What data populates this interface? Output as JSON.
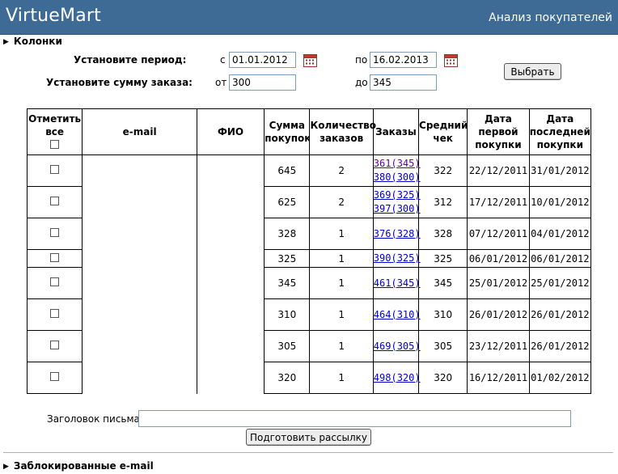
{
  "header": {
    "brand": "VirtueMart",
    "subtitle": "Анализ покупателей"
  },
  "columns_toggle": "Колонки",
  "filters": {
    "period_label": "Установите период:",
    "sum_label": "Установите сумму заказа:",
    "from_date_prefix": "с",
    "to_date_prefix": "по",
    "from_date": "01.01.2012",
    "to_date": "16.02.2013",
    "from_sum_prefix": "от",
    "to_sum_prefix": "до",
    "from_sum": "300",
    "to_sum": "345",
    "select_button": "Выбрать"
  },
  "table": {
    "headers": {
      "select_all_line1": "Отметить",
      "select_all_line2": "все",
      "email": "e-mail",
      "fio": "ФИО",
      "sum_line1": "Сумма",
      "sum_line2": "покупок",
      "count_line1": "Количество",
      "count_line2": "заказов",
      "orders": "Заказы",
      "avg_line1": "Средний",
      "avg_line2": "чек",
      "first_line1": "Дата",
      "first_line2": "первой",
      "first_line3": "покупки",
      "last_line1": "Дата",
      "last_line2": "последней",
      "last_line3": "покупки"
    },
    "rows": [
      {
        "sum": "645",
        "count": "2",
        "orders": [
          "361(345)",
          "380(300)"
        ],
        "avg": "322",
        "first": "22/12/2011",
        "last": "31/01/2012"
      },
      {
        "sum": "625",
        "count": "2",
        "orders": [
          "369(325)",
          "397(300)"
        ],
        "avg": "312",
        "first": "17/12/2011",
        "last": "10/01/2012"
      },
      {
        "sum": "328",
        "count": "1",
        "orders": [
          "376(328)"
        ],
        "avg": "328",
        "first": "07/12/2011",
        "last": "04/01/2012"
      },
      {
        "sum": "325",
        "count": "1",
        "orders": [
          "390(325)"
        ],
        "avg": "325",
        "first": "06/01/2012",
        "last": "06/01/2012"
      },
      {
        "sum": "345",
        "count": "1",
        "orders": [
          "461(345)"
        ],
        "avg": "345",
        "first": "25/01/2012",
        "last": "25/01/2012"
      },
      {
        "sum": "310",
        "count": "1",
        "orders": [
          "464(310)"
        ],
        "avg": "310",
        "first": "26/01/2012",
        "last": "26/01/2012"
      },
      {
        "sum": "305",
        "count": "1",
        "orders": [
          "469(305)"
        ],
        "avg": "305",
        "first": "23/12/2011",
        "last": "26/01/2012"
      },
      {
        "sum": "320",
        "count": "1",
        "orders": [
          "498(320)"
        ],
        "avg": "320",
        "first": "16/12/2011",
        "last": "01/02/2012"
      }
    ]
  },
  "mailing": {
    "subject_label": "Заголовок письма",
    "subject_value": "",
    "prepare_button": "Подготовить рассылку"
  },
  "blocked_toggle": "Заблокированные e-mail",
  "colors": {
    "header_bg": "#3e6b96",
    "link": "#0000cc",
    "link_visited": "#660099"
  }
}
